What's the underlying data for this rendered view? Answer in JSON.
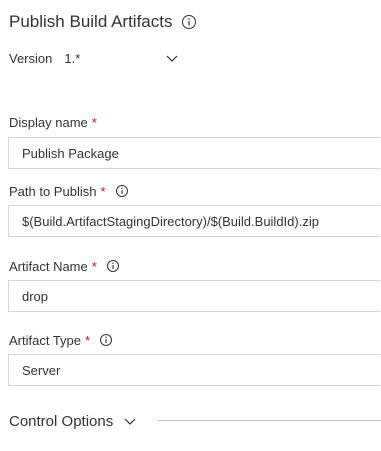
{
  "header": {
    "title": "Publish Build Artifacts"
  },
  "version": {
    "label": "Version",
    "value": "1.*"
  },
  "fields": {
    "display_name": {
      "label": "Display name",
      "required_mark": "*",
      "value": "Publish Package"
    },
    "path_to_publish": {
      "label": "Path to Publish",
      "required_mark": "*",
      "value": "$(Build.ArtifactStagingDirectory)/$(Build.BuildId).zip"
    },
    "artifact_name": {
      "label": "Artifact Name",
      "required_mark": "*",
      "value": "drop"
    },
    "artifact_type": {
      "label": "Artifact Type",
      "required_mark": "*",
      "value": "Server"
    }
  },
  "control_options": {
    "label": "Control Options"
  },
  "colors": {
    "text": "#333333",
    "required": "#c50f1f",
    "border": "#d6d6d6",
    "divider": "#c8c8c8"
  },
  "icons": {
    "info": "info-icon",
    "chevron": "chevron-down-icon"
  }
}
